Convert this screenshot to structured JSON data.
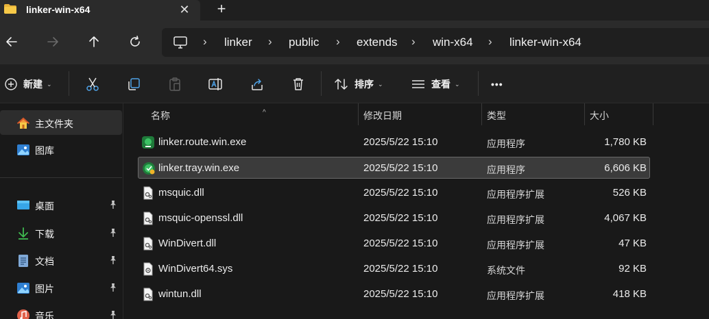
{
  "tab": {
    "title": "linker-win-x64",
    "close_glyph": "✕",
    "new_glyph": "+"
  },
  "breadcrumb": [
    "linker",
    "public",
    "extends",
    "win-x64",
    "linker-win-x64"
  ],
  "toolbar": {
    "new_label": "新建",
    "sort_label": "排序",
    "view_label": "查看",
    "more_glyph": "•••"
  },
  "sidebar": {
    "items": [
      {
        "label": "主文件夹",
        "icon": "home-icon",
        "pinned": false
      },
      {
        "label": "图库",
        "icon": "gallery-icon",
        "pinned": false
      },
      {
        "label": "桌面",
        "icon": "desktop-icon",
        "pinned": true
      },
      {
        "label": "下载",
        "icon": "download-icon",
        "pinned": true
      },
      {
        "label": "文档",
        "icon": "document-icon",
        "pinned": true
      },
      {
        "label": "图片",
        "icon": "pictures-icon",
        "pinned": true
      },
      {
        "label": "音乐",
        "icon": "music-icon",
        "pinned": true
      }
    ]
  },
  "columns": {
    "name": "名称",
    "modified": "修改日期",
    "type": "类型",
    "size": "大小"
  },
  "files": [
    {
      "name": "linker.route.win.exe",
      "modified": "2025/5/22 15:10",
      "type": "应用程序",
      "size": "1,780 KB",
      "icon": "app-icon"
    },
    {
      "name": "linker.tray.win.exe",
      "modified": "2025/5/22 15:10",
      "type": "应用程序",
      "size": "6,606 KB",
      "icon": "app-icon",
      "selected": true
    },
    {
      "name": "msquic.dll",
      "modified": "2025/5/22 15:10",
      "type": "应用程序扩展",
      "size": "526 KB",
      "icon": "dll-icon"
    },
    {
      "name": "msquic-openssl.dll",
      "modified": "2025/5/22 15:10",
      "type": "应用程序扩展",
      "size": "4,067 KB",
      "icon": "dll-icon"
    },
    {
      "name": "WinDivert.dll",
      "modified": "2025/5/22 15:10",
      "type": "应用程序扩展",
      "size": "47 KB",
      "icon": "dll-icon"
    },
    {
      "name": "WinDivert64.sys",
      "modified": "2025/5/22 15:10",
      "type": "系统文件",
      "size": "92 KB",
      "icon": "sys-icon"
    },
    {
      "name": "wintun.dll",
      "modified": "2025/5/22 15:10",
      "type": "应用程序扩展",
      "size": "418 KB",
      "icon": "dll-icon"
    }
  ],
  "colors": {
    "accent": "#0078d4",
    "background": "#191919",
    "toolbar": "#202020",
    "selected_row": "#3b3b3b"
  }
}
